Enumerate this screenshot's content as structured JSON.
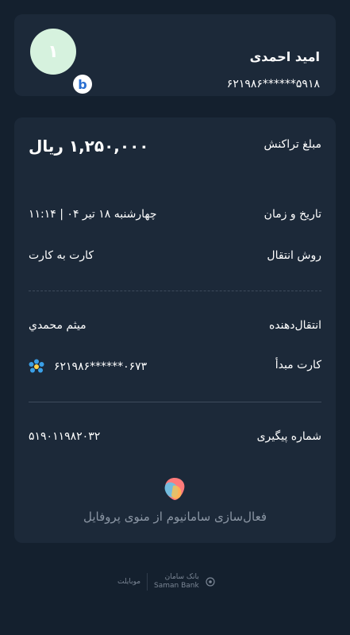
{
  "profile": {
    "name": "امید احمدی",
    "card_number": "۶۲۱۹۸۶******۵۹۱۸",
    "avatar_digit": "۱",
    "bank_badge": "b"
  },
  "transaction": {
    "amount_label": "مبلغ تراکنش",
    "amount_value": "۱,۲۵۰,۰۰۰ ریال",
    "datetime_label": "تاریخ و زمان",
    "datetime_value": "چهارشنبه ۱۸ تیر ۰۴ | ۱۱:۱۴",
    "method_label": "روش انتقال",
    "method_value": "کارت به کارت",
    "sender_label": "انتقال‌دهنده",
    "sender_value": "میثم محمدي",
    "source_card_label": "کارت مبدأ",
    "source_card_value": "۶۲۱۹۸۶******۰۶۷۳",
    "tracking_label": "شماره پیگیری",
    "tracking_value": "۵۱۹۰۱۱۹۸۲۰۳۲",
    "promo_text": "فعال‌سازی سامانیوم از منوی پروفایل"
  },
  "footer": {
    "mobile_label": "موبایلت",
    "bank_name_fa": "بانک سامان",
    "bank_name_en": "Saman Bank"
  },
  "colors": {
    "background": "#14202e",
    "card": "#1c2939",
    "avatar_bg": "#d6f2de",
    "muted_text": "#8b96a4"
  }
}
